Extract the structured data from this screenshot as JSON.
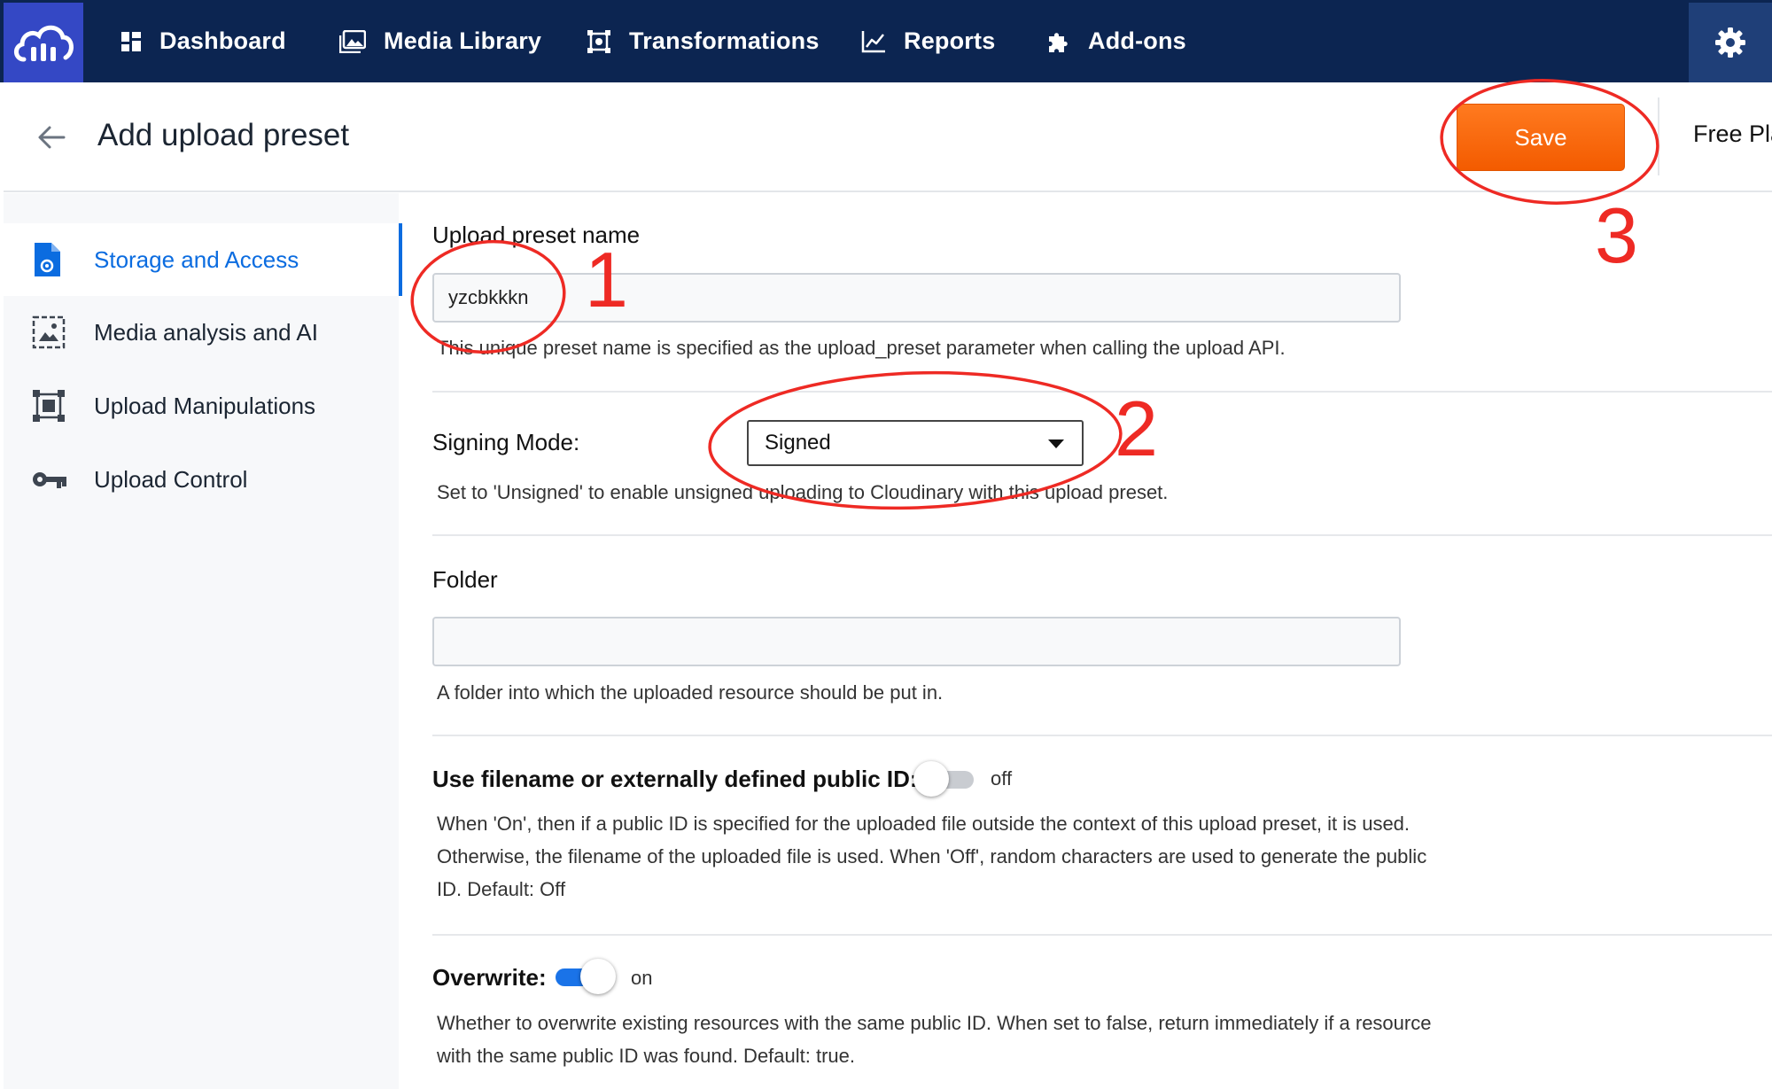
{
  "nav": {
    "items": [
      {
        "label": "Dashboard"
      },
      {
        "label": "Media Library"
      },
      {
        "label": "Transformations"
      },
      {
        "label": "Reports"
      },
      {
        "label": "Add-ons"
      }
    ]
  },
  "header": {
    "title": "Add upload preset",
    "save_label": "Save",
    "plan_label": "Free Pla"
  },
  "sidebar": {
    "items": [
      {
        "label": "Storage and Access",
        "active": true
      },
      {
        "label": "Media analysis and AI"
      },
      {
        "label": "Upload Manipulations"
      },
      {
        "label": "Upload Control"
      }
    ]
  },
  "form": {
    "preset_name": {
      "label": "Upload preset name",
      "value": "yzcbkkkn",
      "help": "This unique preset name is specified as the upload_preset parameter when calling the upload API."
    },
    "signing_mode": {
      "label": "Signing Mode:",
      "value": "Signed",
      "help": "Set to 'Unsigned' to enable unsigned uploading to Cloudinary with this upload preset."
    },
    "folder": {
      "label": "Folder",
      "value": "",
      "help": "A folder into which the uploaded resource should be put in."
    },
    "use_filename": {
      "label": "Use filename or externally defined public ID:",
      "state": "off",
      "help": "When 'On', then if a public ID is specified for the uploaded file outside the context of this upload preset, it is used. Otherwise, the filename of the uploaded file is used. When 'Off', random characters are used to generate the public ID. Default: Off"
    },
    "overwrite": {
      "label": "Overwrite:",
      "state": "on",
      "help": "Whether to overwrite existing resources with the same public ID. When set to false, return immediately if a resource with the same public ID was found. Default: true."
    }
  },
  "annotations": {
    "numbers": [
      "1",
      "2",
      "3"
    ],
    "color": "#ee2a24"
  },
  "colors": {
    "nav_background": "#0c2551",
    "accent": "#0b6ce0",
    "save_button": "#f86a0d"
  }
}
